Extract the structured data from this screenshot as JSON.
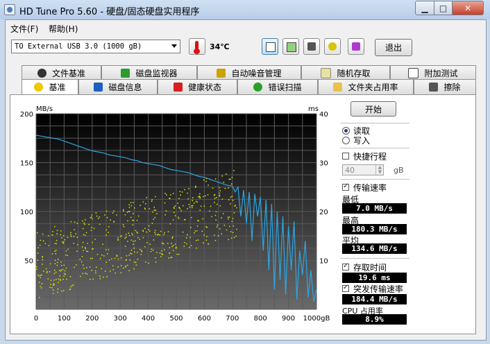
{
  "window": {
    "title": "HD Tune Pro 5.60 - 硬盘/固态硬盘实用程序"
  },
  "menu": {
    "file": "文件(F)",
    "help": "帮助(H)"
  },
  "toolbar": {
    "drive": "TO External USB 3.0 (1000 gB)",
    "temperature": "34℃",
    "exit_label": "退出"
  },
  "tabs_row1": [
    "文件基准",
    "磁盘监视器",
    "自动噪音管理",
    "随机存取",
    "附加测试"
  ],
  "tabs_row2": [
    "基准",
    "磁盘信息",
    "健康状态",
    "错误扫描",
    "文件夹占用率",
    "擦除"
  ],
  "active_tab": "基准",
  "right_panel": {
    "start_label": "开始",
    "read_label": "读取",
    "write_label": "写入",
    "short_stroke_label": "快捷行程",
    "short_stroke_value": "40",
    "short_stroke_unit": "gB",
    "transfer_rate_label": "传输速率",
    "min_label": "最低",
    "min_value": "7.0 MB/s",
    "max_label": "最高",
    "max_value": "180.3 MB/s",
    "avg_label": "平均",
    "avg_value": "134.6 MB/s",
    "access_time_label": "存取时间",
    "access_time_value": "19.6 ms",
    "burst_label": "突发传输速率",
    "burst_value": "184.4 MB/s",
    "cpu_label": "CPU 占用率",
    "cpu_value": "8.9%"
  },
  "chart_data": {
    "type": "line",
    "y_left_label": "MB/s",
    "y_right_label": "ms",
    "x_unit": "gB",
    "x_ticks": [
      "0",
      "100",
      "200",
      "300",
      "400",
      "500",
      "600",
      "700",
      "800",
      "900",
      "1000gB"
    ],
    "y_left_ticks": [
      "200",
      "150",
      "100",
      "50"
    ],
    "y_right_ticks": [
      "40",
      "30",
      "20",
      "10"
    ],
    "xlim": [
      0,
      1000
    ],
    "ylim_left": [
      0,
      200
    ],
    "ylim_right": [
      0,
      40
    ],
    "series": [
      {
        "color": "#2aa7e6",
        "x": [
          0,
          20,
          40,
          60,
          80,
          100,
          120,
          140,
          160,
          180,
          200,
          220,
          240,
          260,
          280,
          300,
          320,
          340,
          360,
          380,
          400,
          420,
          440,
          460,
          480,
          500,
          520,
          540,
          560,
          580,
          600,
          620,
          640,
          660,
          680,
          700,
          710,
          720,
          730,
          740,
          750,
          760,
          770,
          780,
          790,
          800,
          810,
          820,
          830,
          840,
          850,
          860,
          870,
          880,
          890,
          900,
          910,
          920,
          930,
          940,
          950,
          960,
          970,
          980,
          990,
          1000
        ],
        "y": [
          178,
          177,
          176,
          175,
          174,
          172,
          170,
          168,
          166,
          164,
          162,
          161,
          160,
          158,
          157,
          156,
          155,
          153,
          152,
          150,
          149,
          148,
          147,
          145,
          143,
          142,
          141,
          140,
          138,
          136,
          135,
          133,
          131,
          129,
          127,
          126,
          120,
          125,
          95,
          122,
          88,
          120,
          70,
          118,
          95,
          115,
          60,
          112,
          40,
          108,
          20,
          100,
          30,
          95,
          15,
          85,
          40,
          90,
          10,
          60,
          35,
          70,
          12,
          40,
          8,
          20
        ]
      }
    ],
    "scatter": {
      "color": "#e8e800",
      "name": "",
      "description_values": []
    },
    "grid": true
  }
}
